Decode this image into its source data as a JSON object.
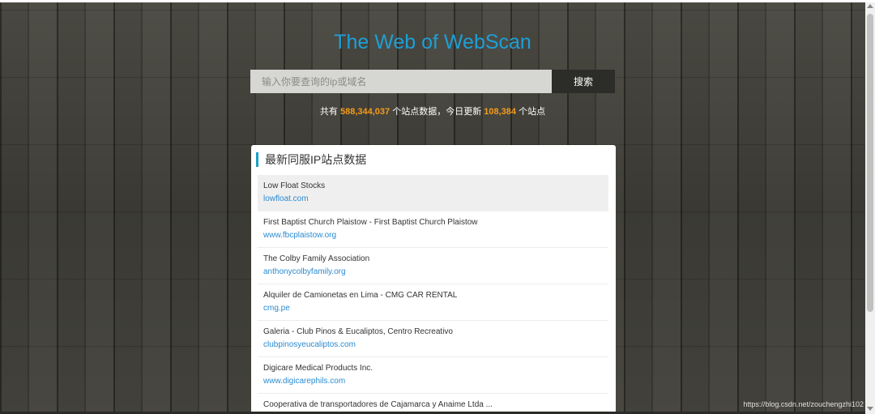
{
  "header": {
    "site_title": "The Web of WebScan"
  },
  "search": {
    "placeholder": "输入你要查询的ip或域名",
    "value": "",
    "button_label": "搜索"
  },
  "stats": {
    "prefix": "共有",
    "total_sites": "588,344,037",
    "middle": "个站点数据，今日更新",
    "today_updated": "108,384",
    "suffix": "个站点"
  },
  "panel": {
    "title": "最新同服IP站点数据",
    "items": [
      {
        "title": "Low Float Stocks",
        "url": "lowfloat.com"
      },
      {
        "title": "First Baptist Church Plaistow - First Baptist Church Plaistow",
        "url": "www.fbcplaistow.org"
      },
      {
        "title": "The Colby Family Association",
        "url": "anthonycolbyfamily.org"
      },
      {
        "title": "Alquiler de Camionetas en Lima - CMG CAR RENTAL",
        "url": "cmg.pe"
      },
      {
        "title": "Galeria - Club Pinos & Eucaliptos, Centro Recreativo",
        "url": "clubpinosyeucaliptos.com"
      },
      {
        "title": "Digicare Medical Products Inc.",
        "url": "www.digicarephils.com"
      },
      {
        "title": "Cooperativa de transportadores de Cajamarca y Anaime Ltda ...",
        "url": ""
      }
    ]
  },
  "watermark": "https://blog.csdn.net/zouchengzhi102",
  "colors": {
    "title_blue": "#1e9fd6",
    "number_orange": "#f59c1a",
    "link_blue": "#2a8bd0",
    "accent_bar": "#1aa0c6"
  }
}
